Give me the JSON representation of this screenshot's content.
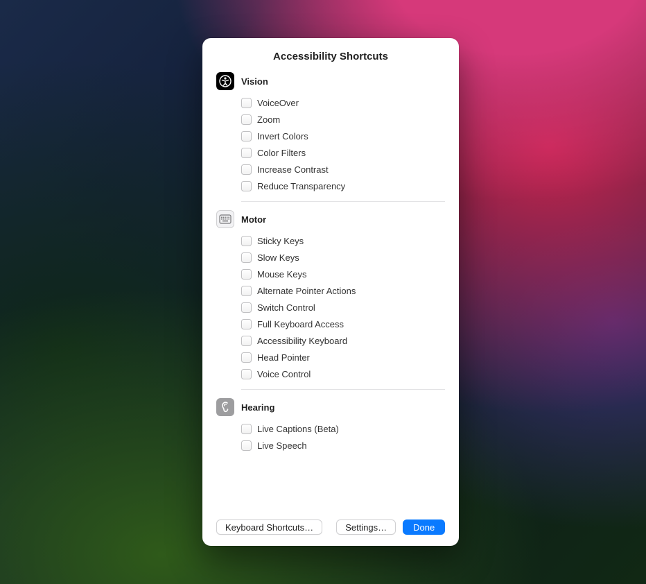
{
  "title": "Accessibility Shortcuts",
  "sections": [
    {
      "id": "vision",
      "title": "Vision",
      "icon": "accessibility-icon",
      "options": [
        {
          "label": "VoiceOver"
        },
        {
          "label": "Zoom"
        },
        {
          "label": "Invert Colors"
        },
        {
          "label": "Color Filters"
        },
        {
          "label": "Increase Contrast"
        },
        {
          "label": "Reduce Transparency"
        }
      ]
    },
    {
      "id": "motor",
      "title": "Motor",
      "icon": "keyboard-icon",
      "options": [
        {
          "label": "Sticky Keys"
        },
        {
          "label": "Slow Keys"
        },
        {
          "label": "Mouse Keys"
        },
        {
          "label": "Alternate Pointer Actions"
        },
        {
          "label": "Switch Control"
        },
        {
          "label": "Full Keyboard Access"
        },
        {
          "label": "Accessibility Keyboard"
        },
        {
          "label": "Head Pointer"
        },
        {
          "label": "Voice Control"
        }
      ]
    },
    {
      "id": "hearing",
      "title": "Hearing",
      "icon": "ear-icon",
      "options": [
        {
          "label": "Live Captions (Beta)"
        },
        {
          "label": "Live Speech"
        }
      ]
    }
  ],
  "buttons": {
    "keyboard": "Keyboard Shortcuts…",
    "settings": "Settings…",
    "done": "Done"
  }
}
